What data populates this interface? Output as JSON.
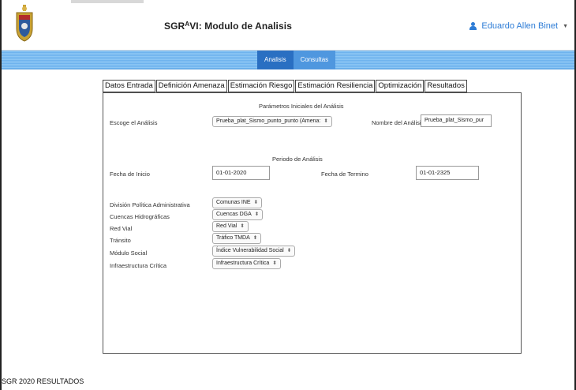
{
  "header": {
    "title_main": "SGR",
    "title_sup": "A",
    "title_rest": "VI: Modulo de Analisis",
    "user_name": "Eduardo Allen Binet"
  },
  "nav": {
    "tabs": [
      {
        "label": "Analisis",
        "active": true
      },
      {
        "label": "Consultas",
        "active": false
      }
    ]
  },
  "form_tabs": [
    "Datos Entrada",
    "Definición Amenaza",
    "Estimación Riesgo",
    "Estimación Resiliencia",
    "Optimización",
    "Resultados"
  ],
  "params_section": {
    "title": "Parámetros Iniciales del Análisis",
    "escoge_label": "Escoge el Análisis",
    "escoge_value": "Prueba_plat_Sismo_punto_punto (Amena:",
    "nombre_label": "Nombre del Análisis",
    "nombre_value": "Prueba_plat_Sismo_pur"
  },
  "period_section": {
    "title": "Periodo de Análisis",
    "inicio_label": "Fecha de Inicio",
    "inicio_value": "01-01-2020",
    "termino_label": "Fecha de Termino",
    "termino_value": "01-01-2325"
  },
  "layers": [
    {
      "label": "División Política Administrativa",
      "value": "Comunas INE"
    },
    {
      "label": "Cuencas Hidrográficas",
      "value": "Cuencas DGA"
    },
    {
      "label": "Red Vial",
      "value": "Red Vial"
    },
    {
      "label": "Tránsito",
      "value": "Tráfico TMDA"
    },
    {
      "label": "Módulo Social",
      "value": "Índice Vulnerabilidad Social"
    },
    {
      "label": "Infraestructura Crítica",
      "value": "Infraestructura Crítica"
    }
  ],
  "footer": {
    "text": "SGR 2020 RESULTADOS"
  },
  "colors": {
    "accent": "#2d7cd6",
    "navbar": "#7dbcf0",
    "active_tab": "#2a6fc2"
  }
}
